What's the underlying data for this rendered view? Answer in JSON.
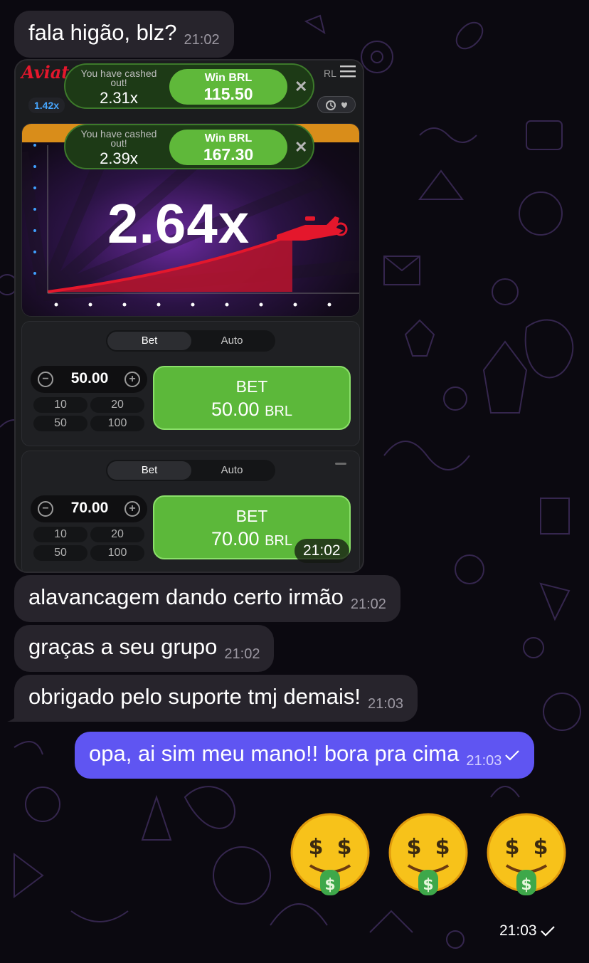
{
  "messages": [
    {
      "text": "fala higão, blz?",
      "time": "21:02",
      "direction": "in"
    },
    {
      "text": "alavancagem dando certo irmão",
      "time": "21:02",
      "direction": "in"
    },
    {
      "text": "graças a seu grupo",
      "time": "21:02",
      "direction": "in"
    },
    {
      "text": "obrigado pelo suporte tmj demais!",
      "time": "21:03",
      "direction": "in"
    },
    {
      "text": "opa, ai sim meu mano!! bora pra cima",
      "time": "21:03",
      "direction": "out"
    }
  ],
  "image_message": {
    "time": "21:02",
    "app_logo": "Aviator",
    "header_currency_fragment": "RL",
    "last_multiplier": "1.42x",
    "current_multiplier": "2.64x",
    "toasts": [
      {
        "message": "You have cashed out!",
        "multiplier": "2.31x",
        "win_label": "Win BRL",
        "win_amount": "115.50"
      },
      {
        "message": "You have cashed out!",
        "multiplier": "2.39x",
        "win_label": "Win BRL",
        "win_amount": "167.30"
      }
    ],
    "bet_panels": [
      {
        "tabs": [
          "Bet",
          "Auto"
        ],
        "amount": "50.00",
        "quick": [
          "10",
          "20",
          "50",
          "100"
        ],
        "button_label": "BET",
        "button_amount": "50.00",
        "button_currency": "BRL"
      },
      {
        "tabs": [
          "Bet",
          "Auto"
        ],
        "amount": "70.00",
        "quick": [
          "10",
          "20",
          "50",
          "100"
        ],
        "button_label": "BET",
        "button_amount": "70.00",
        "button_currency": "BRL"
      }
    ]
  },
  "emoji_message": {
    "emojis": [
      "money-mouth-face",
      "money-mouth-face",
      "money-mouth-face"
    ],
    "time": "21:03"
  },
  "colors": {
    "incoming_bubble": "#27242c",
    "outgoing_bubble": "#5f55f2",
    "background": "#0b0910",
    "bet_green": "#5cb83a",
    "aviator_red": "#e4172c"
  }
}
